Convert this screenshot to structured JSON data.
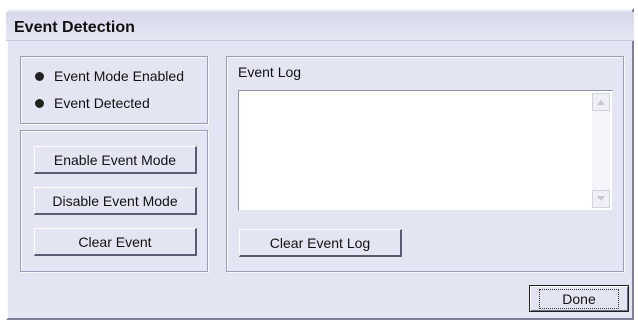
{
  "window": {
    "title": "Event Detection"
  },
  "status": {
    "items": [
      {
        "label": "Event Mode Enabled",
        "icon": "radio-dot-icon"
      },
      {
        "label": "Event Detected",
        "icon": "radio-dot-icon"
      }
    ]
  },
  "controls": {
    "enable_label": "Enable Event Mode",
    "disable_label": "Disable Event Mode",
    "clear_event_label": "Clear Event"
  },
  "log": {
    "label": "Event Log",
    "content": "",
    "clear_label": "Clear Event Log"
  },
  "footer": {
    "done_label": "Done"
  },
  "colors": {
    "window_bg": "#e4e5f3",
    "border_dark": "#5a5a72",
    "border_light": "#ffffff"
  }
}
